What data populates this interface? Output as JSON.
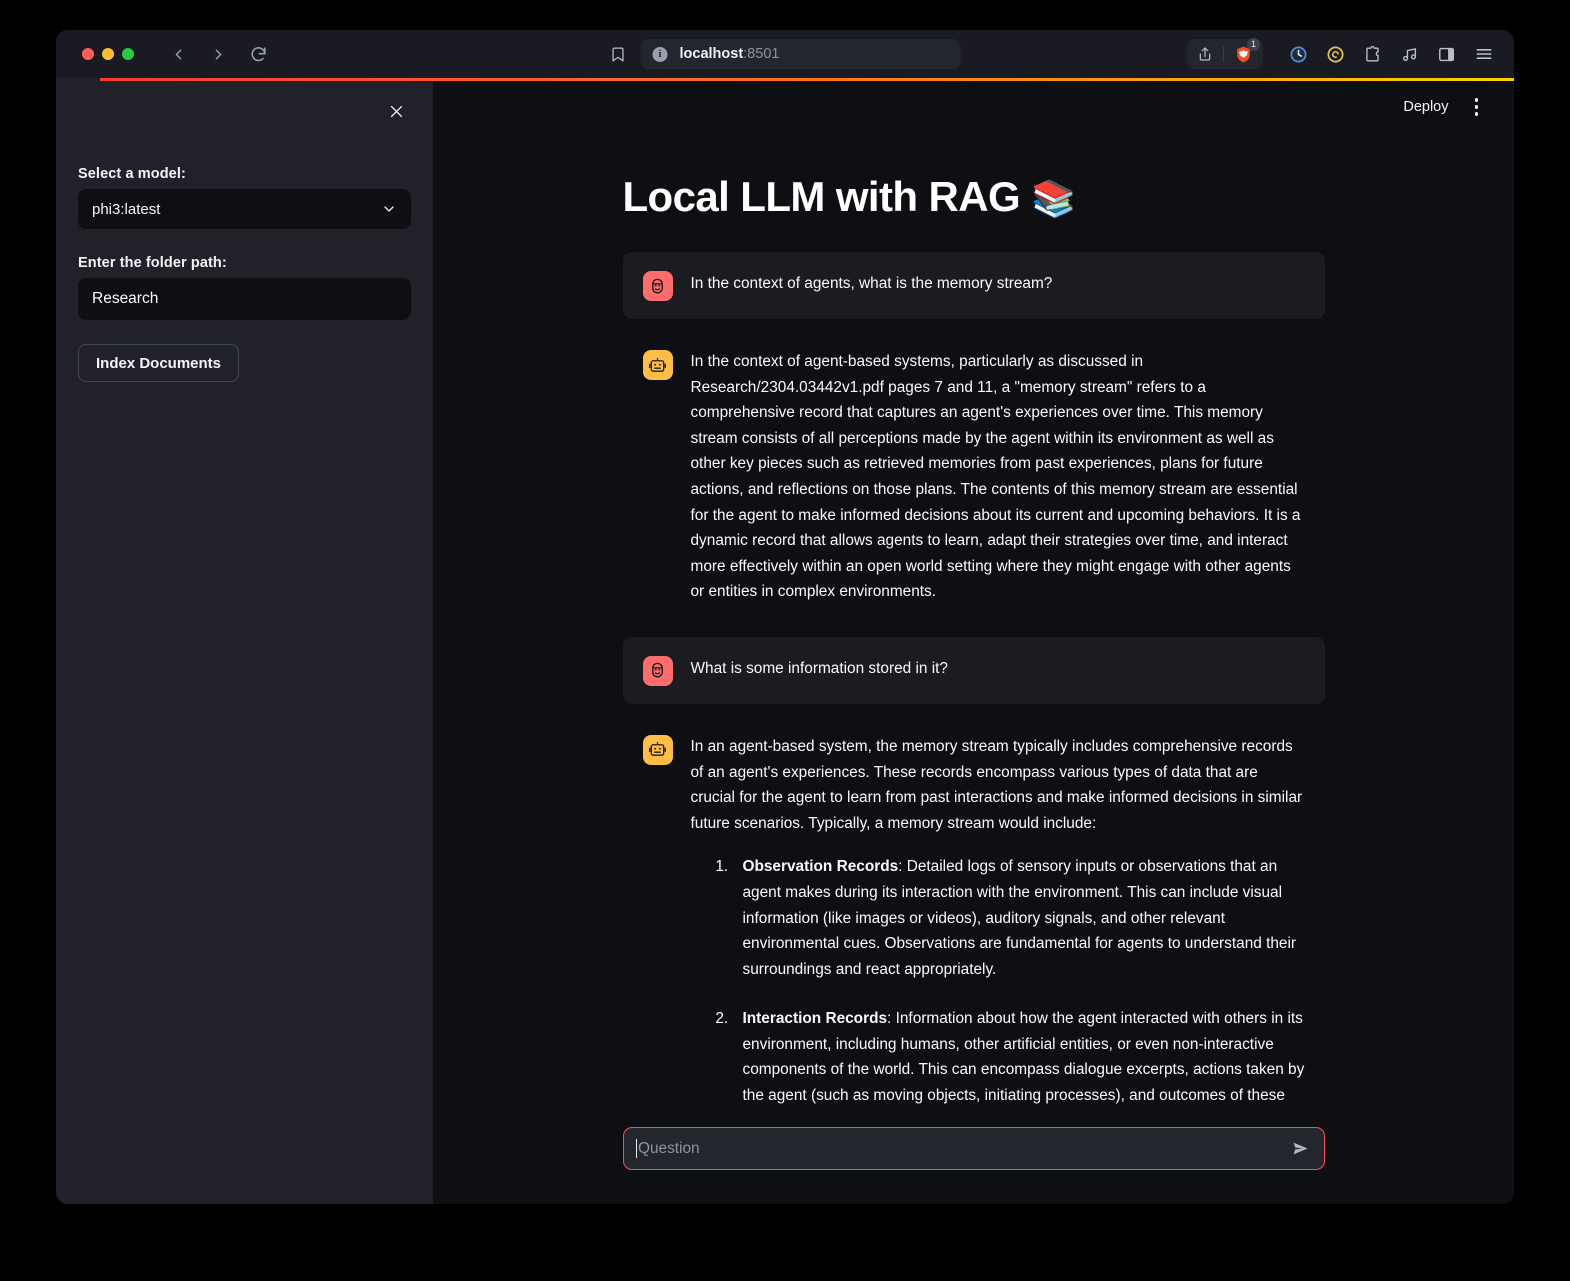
{
  "browser": {
    "url_host": "localhost",
    "url_port": ":8501",
    "brave_shield_count": "1",
    "icons": {
      "back": "back-arrow-icon",
      "forward": "forward-arrow-icon",
      "reload": "reload-icon",
      "bookmark": "bookmark-icon",
      "site_info": "site-info-icon",
      "share": "share-icon",
      "brave_shield": "brave-shield-icon",
      "history": "history-icon",
      "wallet": "brave-wallet-icon",
      "extensions": "extensions-icon",
      "music": "music-icon",
      "sidebar": "sidebar-toggle-icon",
      "menu": "hamburger-menu-icon"
    }
  },
  "sidebar": {
    "close_label": "×",
    "model_label": "Select a model:",
    "model_value": "phi3:latest",
    "folder_label": "Enter the folder path:",
    "folder_value": "Research",
    "index_button": "Index Documents"
  },
  "header": {
    "deploy_label": "Deploy",
    "menu_label": "⋮"
  },
  "main": {
    "title": "Local LLM with RAG",
    "title_emoji": "📚"
  },
  "chat": {
    "messages": [
      {
        "role": "user",
        "text": "In the context of agents, what is the memory stream?"
      },
      {
        "role": "assistant",
        "paragraphs": [
          "In the context of agent-based systems, particularly as discussed in Research/2304.03442v1.pdf pages 7 and 11, a \"memory stream\" refers to a comprehensive record that captures an agent's experiences over time. This memory stream consists of all perceptions made by the agent within its environment as well as other key pieces such as retrieved memories from past experiences, plans for future actions, and reflections on those plans. The contents of this memory stream are essential for the agent to make informed decisions about its current and upcoming behaviors. It is a dynamic record that allows agents to learn, adapt their strategies over time, and interact more effectively within an open world setting where they might engage with other agents or entities in complex environments."
        ]
      },
      {
        "role": "user",
        "text": "What is some information stored in it?"
      },
      {
        "role": "assistant",
        "paragraphs": [
          "In an agent-based system, the memory stream typically includes comprehensive records of an agent's experiences. These records encompass various types of data that are crucial for the agent to learn from past interactions and make informed decisions in similar future scenarios. Typically, a memory stream would include:"
        ],
        "list": [
          {
            "term": "Observation Records",
            "body": ": Detailed logs of sensory inputs or observations that an agent makes during its interaction with the environment. This can include visual information (like images or videos), auditory signals, and other relevant environmental cues. Observations are fundamental for agents to understand their surroundings and react appropriately."
          },
          {
            "term": "Interaction Records",
            "body": ": Information about how the agent interacted with others in its environment, including humans, other artificial entities, or even non-interactive components of the world. This can encompass dialogue excerpts, actions taken by the agent (such as moving objects, initiating processes), and outcomes of these interactions. Interaction records are crucial for understanding social dynamics, collaboration opportunities, and feedback mechanisms."
          }
        ]
      }
    ],
    "input_placeholder": "Question",
    "send_icon": "send-arrow-icon"
  },
  "colors": {
    "accent_red": "#ff4b4b",
    "user_avatar": "#ff6c6c",
    "assistant_avatar": "#ffbd45",
    "sidebar_bg": "#212229",
    "main_bg": "#0e0f13",
    "user_bubble": "#1b1c21"
  }
}
